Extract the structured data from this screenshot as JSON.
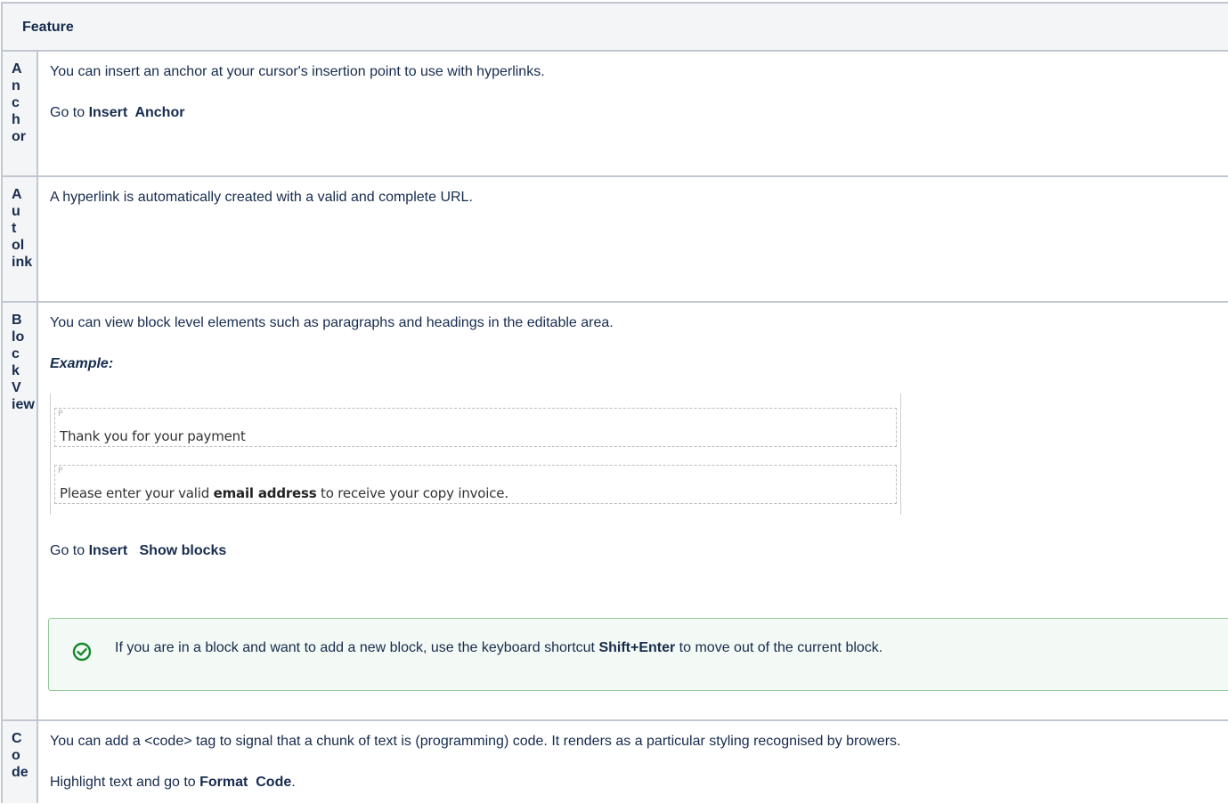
{
  "table": {
    "header": "Feature",
    "rows": [
      {
        "name_lines": "A\nn\nc\nh\nor",
        "p1": "You can insert an anchor at your cursor's insertion point to use with hyperlinks.",
        "p2_prefix": "Go to ",
        "p2_menu": "Insert",
        "p2_sep": "  ",
        "p2_item": "Anchor"
      },
      {
        "name_lines": "A\nu\nt\nol\nink",
        "p1": "A hyperlink is automatically created with a valid and complete URL."
      },
      {
        "name_lines": "B\nlo\nc\nk\nV\niew",
        "p1": "You can view block level elements such as paragraphs and headings in the editable area.",
        "example_label": "Example:",
        "example_block1_tag": "P",
        "example_block1_text": "Thank you for your payment",
        "example_block2_tag": "P",
        "example_block2_pre": "Please enter your valid ",
        "example_block2_bold": "email address",
        "example_block2_post": " to receive your copy invoice.",
        "p2_prefix": "Go to ",
        "p2_menu": "Insert",
        "p2_sep": "   ",
        "p2_item": "Show blocks",
        "tip_pre": "If you are in a block and want to add a new block, use the keyboard shortcut ",
        "tip_bold": "Shift+Enter",
        "tip_post": " to move out of the current block.",
        "tip_color": "#14892c"
      },
      {
        "name_lines": "C\no\nde",
        "p1": "You can add a <code> tag to signal that a chunk of text is (programming) code. It renders as a particular styling recognised by browers.",
        "p2_prefix": "Highlight text and go to ",
        "p2_menu": "Format",
        "p2_sep": "  ",
        "p2_item": "Code",
        "p2_suffix": "."
      }
    ]
  }
}
